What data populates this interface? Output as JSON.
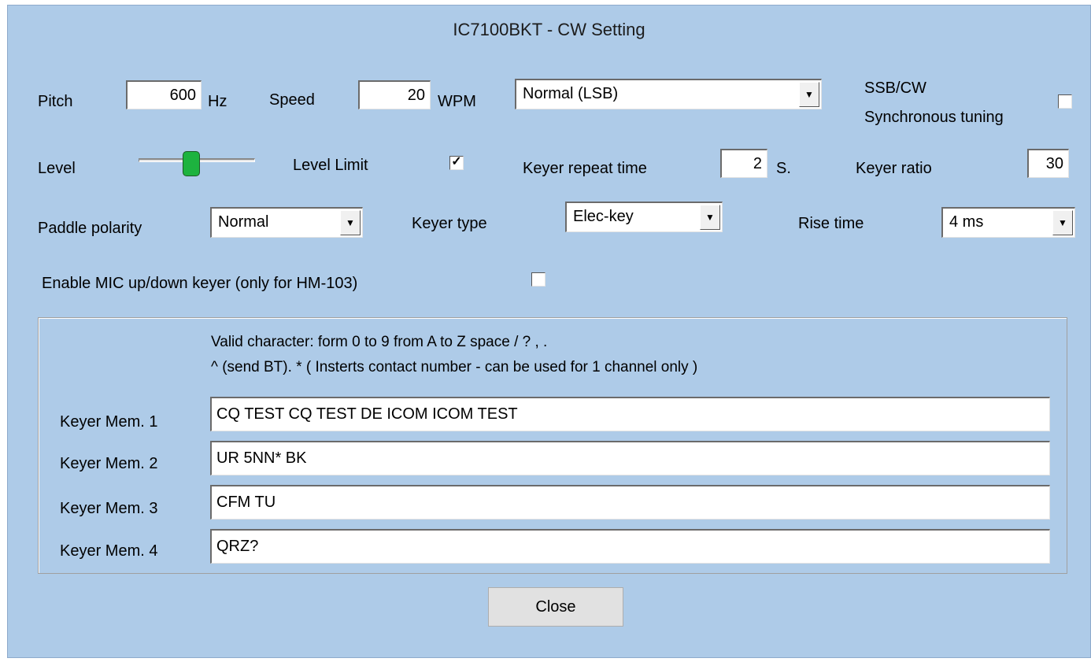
{
  "window": {
    "title": "IC7100BKT - CW Setting"
  },
  "pitch": {
    "label": "Pitch",
    "value": "600",
    "unit": "Hz"
  },
  "speed": {
    "label": "Speed",
    "value": "20",
    "unit": "WPM"
  },
  "mode_select": {
    "value": "Normal (LSB)"
  },
  "sync_tuning": {
    "label_line1": "SSB/CW",
    "label_line2": "Synchronous tuning",
    "checked": false
  },
  "level": {
    "label": "Level",
    "slider_fraction": 0.45
  },
  "level_limit": {
    "label": "Level Limit",
    "checked": true
  },
  "keyer_repeat": {
    "label": "Keyer repeat time",
    "value": "2",
    "unit": "S."
  },
  "keyer_ratio": {
    "label": "Keyer ratio",
    "value": "30"
  },
  "paddle_polarity": {
    "label": "Paddle polarity",
    "value": "Normal"
  },
  "keyer_type": {
    "label": "Keyer type",
    "value": "Elec-key"
  },
  "rise_time": {
    "label": "Rise time",
    "value": "4 ms"
  },
  "mic_keyer": {
    "label": "Enable MIC up/down keyer (only for HM-103)",
    "checked": false
  },
  "memory": {
    "help_line1": "Valid character: form 0 to 9  from A to Z  space  /  ?  ,  .",
    "help_line2": "^ (send BT). * ( Insterts contact number - can be used for 1 channel only )",
    "items": [
      {
        "label": "Keyer Mem. 1",
        "value": "CQ TEST CQ TEST DE ICOM ICOM TEST"
      },
      {
        "label": "Keyer Mem. 2",
        "value": "UR 5NN* BK"
      },
      {
        "label": "Keyer Mem. 3",
        "value": "CFM TU"
      },
      {
        "label": "Keyer Mem. 4",
        "value": "QRZ?"
      }
    ]
  },
  "close_button": {
    "label": "Close"
  },
  "colors": {
    "title_bar": "#aecbe8",
    "client_bg": "#f0f0f0",
    "slider_thumb": "#1db33f"
  },
  "icons": {
    "dropdown": "triangle-down",
    "check": "check-mark"
  }
}
